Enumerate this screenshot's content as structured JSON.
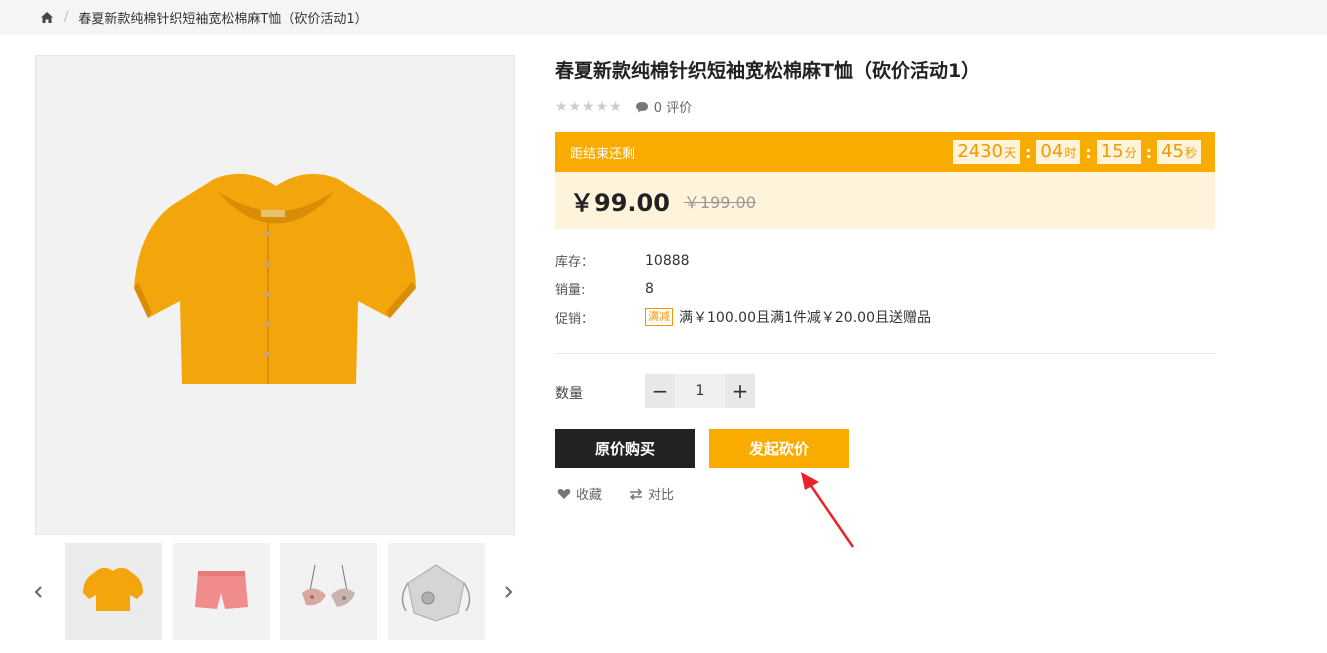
{
  "breadcrumb": {
    "home_icon": "home-icon",
    "separator": "/",
    "current": "春夏新款纯棉针织短袖宽松棉麻T恤（砍价活动1）"
  },
  "product": {
    "title": "春夏新款纯棉针织短袖宽松棉麻T恤（砍价活动1）",
    "stars": "★★★★★",
    "comments": "0 评价"
  },
  "countdown": {
    "label": "距结束还剩",
    "days": "2430",
    "days_unit": "天",
    "hours": "04",
    "hours_unit": "时",
    "minutes": "15",
    "minutes_unit": "分",
    "seconds": "45",
    "seconds_unit": "秒",
    "colon": ":"
  },
  "price": {
    "current": "￥99.00",
    "original": "￥199.00"
  },
  "info": {
    "stock_label": "库存：",
    "stock_value": "10888",
    "sales_label": "销量:",
    "sales_value": "8",
    "promo_label": "促销：",
    "promo_tag": "满减",
    "promo_text": "满￥100.00且满1件减￥20.00且送赠品"
  },
  "quantity": {
    "label": "数量",
    "value": "1",
    "minus": "−",
    "plus": "+"
  },
  "buttons": {
    "buy": "原价购买",
    "bargain": "发起砍价",
    "favorite": "收藏",
    "compare": "对比"
  },
  "colors": {
    "accent": "#faab00",
    "accent_light": "#fff4db",
    "dark_button": "#222222",
    "arrow": "#e8232a"
  }
}
